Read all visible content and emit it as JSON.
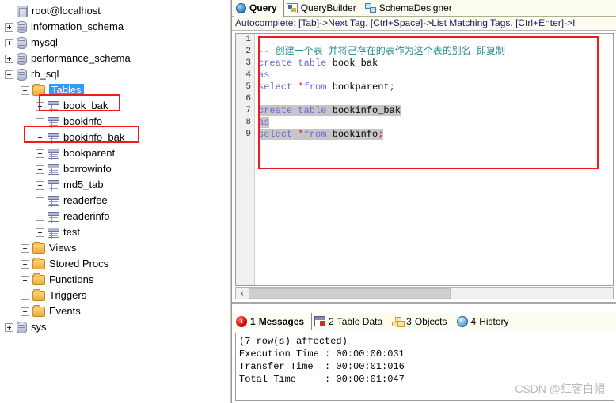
{
  "sidebar": {
    "root": {
      "label": "root@localhost",
      "icon": "server-icon"
    },
    "databases": [
      {
        "label": "information_schema",
        "icon": "database-icon",
        "expanded": false
      },
      {
        "label": "mysql",
        "icon": "database-icon",
        "expanded": false
      },
      {
        "label": "performance_schema",
        "icon": "database-icon",
        "expanded": false
      },
      {
        "label": "rb_sql",
        "icon": "database-icon",
        "expanded": true
      }
    ],
    "tables_folder": {
      "label": "Tables",
      "icon": "folder-icon",
      "selected": true
    },
    "tables": [
      {
        "label": "book_bak",
        "icon": "table-icon",
        "highlighted": true
      },
      {
        "label": "bookinfo",
        "icon": "table-icon",
        "highlighted": false
      },
      {
        "label": "bookinfo_bak",
        "icon": "table-icon",
        "highlighted": true
      },
      {
        "label": "bookparent",
        "icon": "table-icon",
        "highlighted": false
      },
      {
        "label": "borrowinfo",
        "icon": "table-icon",
        "highlighted": false
      },
      {
        "label": "md5_tab",
        "icon": "table-icon",
        "highlighted": false
      },
      {
        "label": "readerfee",
        "icon": "table-icon",
        "highlighted": false
      },
      {
        "label": "readerinfo",
        "icon": "table-icon",
        "highlighted": false
      },
      {
        "label": "test",
        "icon": "table-icon",
        "highlighted": false
      }
    ],
    "db_folders": [
      {
        "label": "Views",
        "icon": "folder-icon"
      },
      {
        "label": "Stored Procs",
        "icon": "folder-icon"
      },
      {
        "label": "Functions",
        "icon": "folder-icon"
      },
      {
        "label": "Triggers",
        "icon": "folder-icon"
      },
      {
        "label": "Events",
        "icon": "folder-icon"
      }
    ],
    "sys_db": {
      "label": "sys",
      "icon": "database-icon"
    }
  },
  "top_tabs": [
    {
      "label": "Query",
      "icon": "globe-icon",
      "active": true
    },
    {
      "label": "QueryBuilder",
      "icon": "query-builder-icon",
      "active": false
    },
    {
      "label": "SchemaDesigner",
      "icon": "schema-designer-icon",
      "active": false
    }
  ],
  "autocomplete_hint": "Autocomplete: [Tab]->Next Tag. [Ctrl+Space]->List Matching Tags. [Ctrl+Enter]->I",
  "editor": {
    "line_numbers": [
      "1",
      "2",
      "3",
      "4",
      "5",
      "6",
      "7",
      "8",
      "9"
    ],
    "lines": [
      {
        "n": 1,
        "tokens": [],
        "selected": false
      },
      {
        "n": 2,
        "tokens": [
          {
            "t": "-- 创建一个表 并将己存在的表作为这个表的别名 即复制",
            "c": "cmt"
          }
        ],
        "selected": false
      },
      {
        "n": 3,
        "tokens": [
          {
            "t": "create table ",
            "c": "kw"
          },
          {
            "t": "book_bak",
            "c": "ident"
          }
        ],
        "selected": false
      },
      {
        "n": 4,
        "tokens": [
          {
            "t": "as",
            "c": "kw"
          }
        ],
        "selected": false
      },
      {
        "n": 5,
        "tokens": [
          {
            "t": "select ",
            "c": "kw"
          },
          {
            "t": "*",
            "c": "op"
          },
          {
            "t": "from ",
            "c": "kw"
          },
          {
            "t": "bookparent",
            "c": "ident"
          },
          {
            "t": ";",
            "c": "punct"
          }
        ],
        "selected": false
      },
      {
        "n": 6,
        "tokens": [],
        "selected": false
      },
      {
        "n": 7,
        "tokens": [
          {
            "t": "create table ",
            "c": "kw"
          },
          {
            "t": "bookinfo_bak",
            "c": "ident"
          }
        ],
        "selected": true
      },
      {
        "n": 8,
        "tokens": [
          {
            "t": "as",
            "c": "kw"
          }
        ],
        "selected": true
      },
      {
        "n": 9,
        "tokens": [
          {
            "t": "select ",
            "c": "kw"
          },
          {
            "t": "*",
            "c": "op"
          },
          {
            "t": "from ",
            "c": "kw"
          },
          {
            "t": "bookinfo",
            "c": "ident"
          },
          {
            "t": ";",
            "c": "punct"
          }
        ],
        "selected": true
      }
    ],
    "scroll_left_arrow": "‹"
  },
  "bottom_tabs": [
    {
      "num": "1",
      "label": "Messages",
      "icon": "info-icon",
      "active": true
    },
    {
      "num": "2",
      "label": "Table Data",
      "icon": "table-data-icon",
      "active": false
    },
    {
      "num": "3",
      "label": "Objects",
      "icon": "objects-icon",
      "active": false
    },
    {
      "num": "4",
      "label": "History",
      "icon": "history-icon",
      "active": false
    }
  ],
  "messages": "(7 row(s) affected)\nExecution Time : 00:00:00:031\nTransfer Time  : 00:00:01:016\nTotal Time     : 00:00:01:047",
  "watermark": "CSDN @红客白帽",
  "colors": {
    "selection_blue": "#3399ff",
    "annotation_red": "#ee1c1c",
    "keyword": "#6b6bd6",
    "comment": "#1f8a8a",
    "operator": "#c02020",
    "tab_background": "#fdfcf0"
  }
}
